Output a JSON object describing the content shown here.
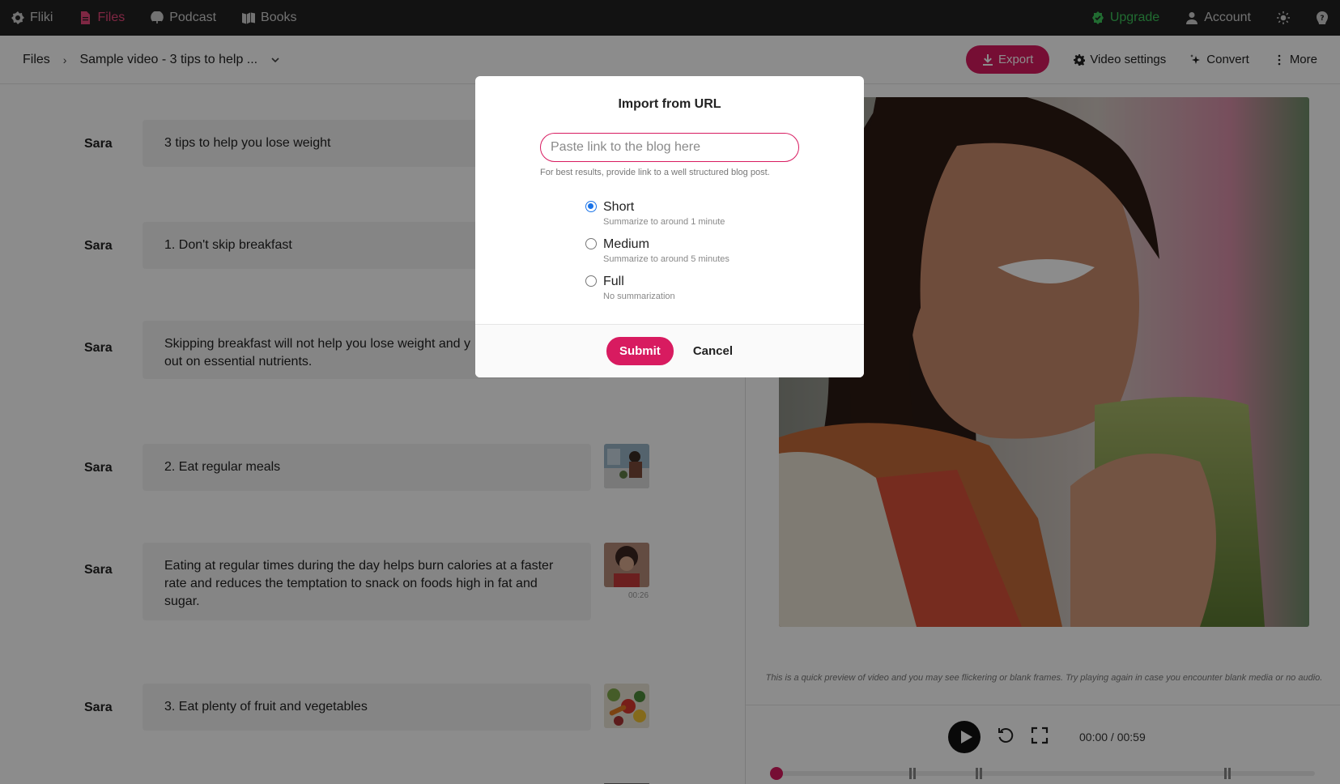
{
  "topnav": {
    "items": [
      {
        "label": "Fliki",
        "icon": "fliki-logo-icon"
      },
      {
        "label": "Files",
        "icon": "file-icon",
        "active": true
      },
      {
        "label": "Podcast",
        "icon": "podcast-icon"
      },
      {
        "label": "Books",
        "icon": "book-icon"
      }
    ],
    "upgrade_label": "Upgrade",
    "account_label": "Account"
  },
  "toolbar": {
    "crumb_root": "Files",
    "crumb_file": "Sample video - 3 tips to help ...",
    "export_label": "Export",
    "video_settings_label": "Video settings",
    "convert_label": "Convert",
    "more_label": "More"
  },
  "script": {
    "rows": [
      {
        "speaker": "Sara",
        "text": "3 tips to help you lose weight"
      },
      {
        "speaker": "Sara",
        "text": "1. Don't skip breakfast"
      },
      {
        "speaker": "Sara",
        "text": "Skipping breakfast will not help you lose weight and y\nout on essential nutrients."
      },
      {
        "speaker": "Sara",
        "text": "2. Eat regular meals"
      },
      {
        "speaker": "Sara",
        "text": "Eating at regular times during the day helps burn calories at a faster rate and reduces the temptation to snack on foods high in fat and sugar.",
        "thumb_time": "00:26"
      },
      {
        "speaker": "Sara",
        "text": "3. Eat plenty of fruit and vegetables"
      }
    ]
  },
  "preview": {
    "note": "This is a quick preview of video and you may see flickering or blank frames. Try playing again in case you encounter blank media or no audio.",
    "time": "00:00 / 00:59",
    "progress": 0
  },
  "modal": {
    "title": "Import from URL",
    "input_placeholder": "Paste link to the blog here",
    "input_value": "",
    "hint": "For best results, provide link to a well structured blog post.",
    "options": [
      {
        "label": "Short",
        "description": "Summarize to around 1 minute",
        "checked": true
      },
      {
        "label": "Medium",
        "description": "Summarize to around 5 minutes",
        "checked": false
      },
      {
        "label": "Full",
        "description": "No summarization",
        "checked": false
      }
    ],
    "submit_label": "Submit",
    "cancel_label": "Cancel"
  },
  "colors": {
    "accent": "#d81b60",
    "upgrade": "#3cc45a",
    "nav_bg": "#212121",
    "radio_checked": "#1a73e8"
  }
}
